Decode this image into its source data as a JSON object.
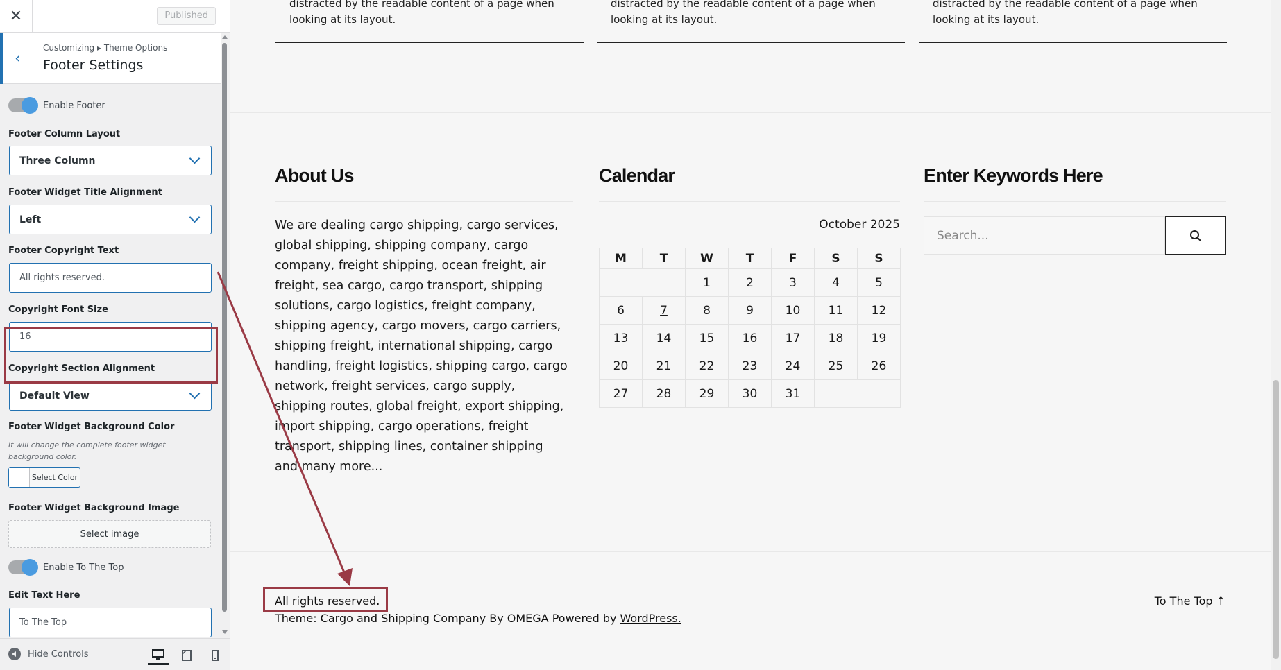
{
  "customizer": {
    "published_label": "Published",
    "breadcrumb": "Customizing ▸ Theme Options",
    "section_title": "Footer Settings",
    "enable_footer_label": "Enable Footer",
    "footer_column_layout": {
      "label": "Footer Column Layout",
      "value": "Three Column"
    },
    "footer_widget_title_alignment": {
      "label": "Footer Widget Title Alignment",
      "value": "Left"
    },
    "footer_copyright_text": {
      "label": "Footer Copyright Text",
      "value": "All rights reserved."
    },
    "copyright_font_size": {
      "label": "Copyright Font Size",
      "value": "16"
    },
    "copyright_section_alignment": {
      "label": "Copyright Section Alignment",
      "value": "Default View"
    },
    "footer_widget_bg_color": {
      "label": "Footer Widget Background Color",
      "description": "It will change the complete footer widget background color.",
      "button_label": "Select Color"
    },
    "footer_widget_bg_image": {
      "label": "Footer Widget Background Image",
      "button_label": "Select image"
    },
    "enable_to_top_label": "Enable To The Top",
    "edit_text": {
      "label": "Edit Text Here",
      "value": "To The Top"
    },
    "hide_controls_label": "Hide Controls",
    "accent_color": "#2271b1"
  },
  "preview": {
    "top_card_text": "distracted by the readable content of a page when looking at its layout.",
    "about": {
      "title": "About Us",
      "text": "We are dealing cargo shipping, cargo services, global shipping, shipping company, cargo company, freight shipping, ocean freight, air freight, sea cargo, cargo transport, shipping solutions, cargo logistics, freight company, shipping agency, cargo movers, cargo carriers, shipping freight, international shipping, cargo handling, freight logistics, shipping cargo, cargo network, freight services, cargo supply, shipping routes, global freight, export shipping, import shipping, cargo operations, freight transport, shipping lines, container shipping and many more..."
    },
    "calendar": {
      "title": "Calendar",
      "month": "October 2025",
      "weekdays": [
        "M",
        "T",
        "W",
        "T",
        "F",
        "S",
        "S"
      ],
      "weeks": [
        [
          "",
          "",
          "1",
          "2",
          "3",
          "4",
          "5"
        ],
        [
          "6",
          "7",
          "8",
          "9",
          "10",
          "11",
          "12"
        ],
        [
          "13",
          "14",
          "15",
          "16",
          "17",
          "18",
          "19"
        ],
        [
          "20",
          "21",
          "22",
          "23",
          "24",
          "25",
          "26"
        ],
        [
          "27",
          "28",
          "29",
          "30",
          "31",
          "",
          ""
        ]
      ],
      "linked_day": "7"
    },
    "search": {
      "title": "Enter Keywords Here",
      "placeholder": "Search..."
    },
    "copyright": "All rights reserved.",
    "theme_prefix": "Theme: Cargo and Shipping Company By OMEGA Powered by ",
    "theme_link": "WordPress.",
    "to_top": "To The Top ↑",
    "highlight_color": "#9a3a45"
  }
}
